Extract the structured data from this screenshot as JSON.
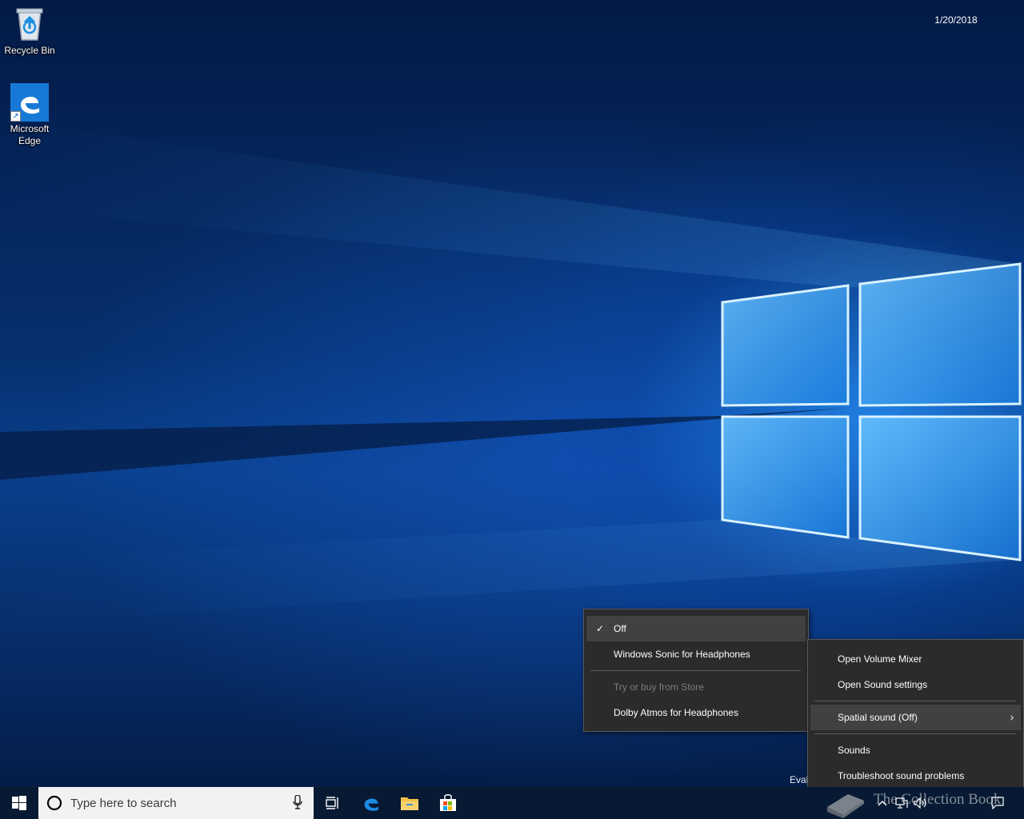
{
  "desktop": {
    "icons": [
      {
        "label": "Recycle Bin",
        "icon": "recycle-bin-icon"
      },
      {
        "label": "Microsoft Edge",
        "icon": "edge-icon"
      }
    ],
    "evaluation_text": "Eval"
  },
  "spatial_submenu": {
    "items": [
      {
        "label": "Off",
        "checked": true,
        "highlighted": true
      },
      {
        "label": "Windows Sonic for Headphones",
        "checked": false
      },
      {
        "label": "Try or buy from Store",
        "disabled": true
      },
      {
        "label": "Dolby Atmos for Headphones",
        "checked": false
      }
    ]
  },
  "sound_menu": {
    "items": [
      {
        "label": "Open Volume Mixer"
      },
      {
        "label": "Open Sound settings"
      },
      {
        "label": "Spatial sound (Off)",
        "has_submenu": true,
        "highlighted": true
      },
      {
        "label": "Sounds"
      },
      {
        "label": "Troubleshoot sound problems"
      }
    ]
  },
  "taskbar": {
    "search_placeholder": "Type here to search",
    "pinned": [
      "task-view-icon",
      "edge-icon",
      "file-explorer-icon",
      "store-icon"
    ],
    "clock_date": "1/20/2018",
    "tray_icons": [
      "show-hidden-icons-chevron-icon",
      "network-icon",
      "volume-icon",
      "action-center-icon"
    ]
  },
  "watermark": {
    "text": "The Collection Book"
  },
  "colors": {
    "menu_bg": "#2b2b2b",
    "menu_hover": "#414141",
    "taskbar_bg": "#081a33",
    "accent": "#1779d6"
  }
}
